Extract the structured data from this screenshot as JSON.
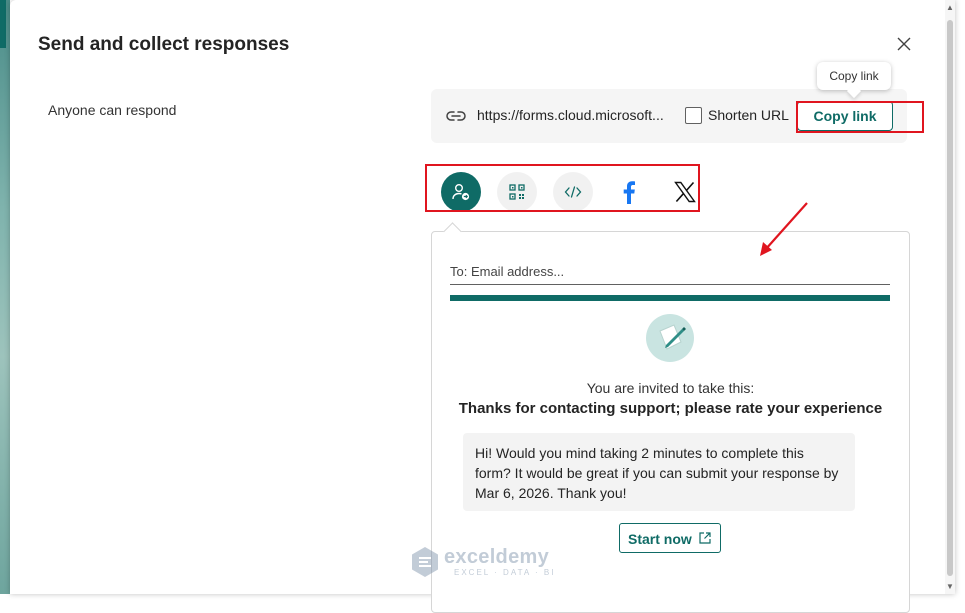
{
  "dialog": {
    "title": "Send and collect responses",
    "audience": "Anyone can respond"
  },
  "link": {
    "url": "https://forms.cloud.microsoft...",
    "shorten_label": "Shorten URL",
    "shorten_checked": false,
    "copy_label": "Copy link",
    "tooltip": "Copy link"
  },
  "share_options": [
    {
      "name": "invite-people-icon",
      "active": true
    },
    {
      "name": "qr-code-icon",
      "active": false
    },
    {
      "name": "embed-code-icon",
      "active": false
    },
    {
      "name": "facebook-icon",
      "active": false
    },
    {
      "name": "x-twitter-icon",
      "active": false
    }
  ],
  "email": {
    "placeholder": "To: Email address...",
    "invite_line": "You are invited to take this:",
    "form_title": "Thanks for contacting support; please rate your experience",
    "message": "Hi! Would you mind taking 2 minutes to complete this form? It would be great if you can submit your response by Mar 6, 2026. Thank you!",
    "start_label": "Start now"
  },
  "watermark": {
    "name": "exceldemy",
    "tagline": "EXCEL · DATA · BI"
  },
  "colors": {
    "accent": "#0f6b66",
    "highlight": "#e0151f",
    "facebook": "#1877f2"
  }
}
